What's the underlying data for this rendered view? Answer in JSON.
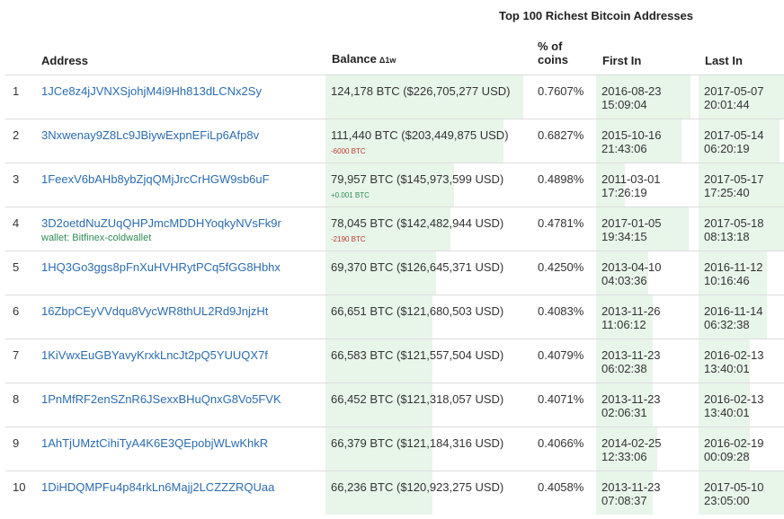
{
  "page_title": "Top 100 Richest Bitcoin Addresses",
  "columns": {
    "address": "Address",
    "balance": "Balance",
    "balance_sub": "Δ1w",
    "pct_line1": "% of",
    "pct_line2": "coins",
    "first_in": "First In",
    "last_in": "Last In"
  },
  "rows": [
    {
      "rank": "1",
      "address": "1JCe8z4jJVNXSjohjM4i9Hh813dLCNx2Sy",
      "wallet": "",
      "balance": "124,178 BTC ($226,705,277 USD)",
      "delta": "",
      "pct": "0.7607%",
      "first_in": "2016-08-23 15:09:04",
      "last_in": "2017-05-07 20:01:44"
    },
    {
      "rank": "2",
      "address": "3Nxwenay9Z8Lc9JBiywExpnEFiLp6Afp8v",
      "wallet": "",
      "balance": "111,440 BTC ($203,449,875 USD)",
      "delta": "-6000 BTC",
      "pct": "0.6827%",
      "first_in": "2015-10-16 21:43:06",
      "last_in": "2017-05-14 06:20:19"
    },
    {
      "rank": "3",
      "address": "1FeexV6bAHb8ybZjqQMjJrcCrHGW9sb6uF",
      "wallet": "",
      "balance": "79,957 BTC ($145,973,599 USD)",
      "delta": "+0.001 BTC",
      "pct": "0.4898%",
      "first_in": "2011-03-01 17:26:19",
      "last_in": "2017-05-17 17:25:40"
    },
    {
      "rank": "4",
      "address": "3D2oetdNuZUqQHPJmcMDDHYoqkyNVsFk9r",
      "wallet": "wallet: Bitfinex-coldwallet",
      "balance": "78,045 BTC ($142,482,944 USD)",
      "delta": "-2190 BTC",
      "pct": "0.4781%",
      "first_in": "2017-01-05 19:34:15",
      "last_in": "2017-05-18 08:13:18"
    },
    {
      "rank": "5",
      "address": "1HQ3Go3ggs8pFnXuHVHRytPCq5fGG8Hbhx",
      "wallet": "",
      "balance": "69,370 BTC ($126,645,371 USD)",
      "delta": "",
      "pct": "0.4250%",
      "first_in": "2013-04-10 04:03:36",
      "last_in": "2016-11-12 10:16:46"
    },
    {
      "rank": "6",
      "address": "16ZbpCEyVVdqu8VycWR8thUL2Rd9JnjzHt",
      "wallet": "",
      "balance": "66,651 BTC ($121,680,503 USD)",
      "delta": "",
      "pct": "0.4083%",
      "first_in": "2013-11-26 11:06:12",
      "last_in": "2016-11-14 06:32:38"
    },
    {
      "rank": "7",
      "address": "1KiVwxEuGBYavyKrxkLncJt2pQ5YUUQX7f",
      "wallet": "",
      "balance": "66,583 BTC ($121,557,504 USD)",
      "delta": "",
      "pct": "0.4079%",
      "first_in": "2013-11-23 06:02:38",
      "last_in": "2016-02-13 13:40:01"
    },
    {
      "rank": "8",
      "address": "1PnMfRF2enSZnR6JSexxBHuQnxG8Vo5FVK",
      "wallet": "",
      "balance": "66,452 BTC ($121,318,057 USD)",
      "delta": "",
      "pct": "0.4071%",
      "first_in": "2013-11-23 02:06:31",
      "last_in": "2016-02-13 13:40:01"
    },
    {
      "rank": "9",
      "address": "1AhTjUMztCihiTyA4K6E3QEpobjWLwKhkR",
      "wallet": "",
      "balance": "66,379 BTC ($121,184,316 USD)",
      "delta": "",
      "pct": "0.4066%",
      "first_in": "2014-02-25 12:33:06",
      "last_in": "2016-02-19 00:09:28"
    },
    {
      "rank": "10",
      "address": "1DiHDQMPFu4p84rkLn6Majj2LCZZZRQUaa",
      "wallet": "",
      "balance": "66,236 BTC ($120,923,275 USD)",
      "delta": "",
      "pct": "0.4058%",
      "first_in": "2013-11-23 07:08:37",
      "last_in": "2017-05-10 23:05:00"
    }
  ],
  "bars": [
    {
      "balance": 1.0,
      "first": 1.0,
      "last": 1.0
    },
    {
      "balance": 0.9,
      "first": 0.9,
      "last": 0.95
    },
    {
      "balance": 0.65,
      "first": 0.3,
      "last": 1.0
    },
    {
      "balance": 0.63,
      "first": 0.98,
      "last": 1.0
    },
    {
      "balance": 0.56,
      "first": 0.55,
      "last": 0.8
    },
    {
      "balance": 0.54,
      "first": 0.6,
      "last": 0.8
    },
    {
      "balance": 0.54,
      "first": 0.6,
      "last": 0.6
    },
    {
      "balance": 0.54,
      "first": 0.6,
      "last": 0.6
    },
    {
      "balance": 0.54,
      "first": 0.65,
      "last": 0.6
    },
    {
      "balance": 0.54,
      "first": 0.6,
      "last": 1.0
    }
  ],
  "colors": {
    "link": "#2b6cb0",
    "wallet": "#2e8b57",
    "highlight": "#e8f6ea",
    "delta_pos": "#2e8b57",
    "delta_neg": "#c0392b"
  }
}
